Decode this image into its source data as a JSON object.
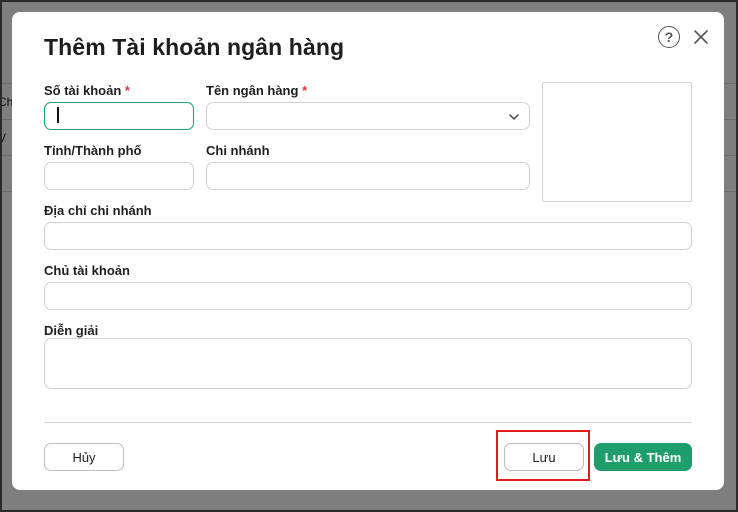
{
  "backdrop": {
    "rows": [
      "Ch",
      "V"
    ]
  },
  "modal": {
    "title": "Thêm Tài khoản ngân hàng",
    "help_glyph": "?",
    "fields": {
      "account_number": {
        "label": "Số tài khoản",
        "required_mark": "*",
        "value": ""
      },
      "bank_name": {
        "label": "Tên ngân hàng",
        "required_mark": "*",
        "value": ""
      },
      "province": {
        "label": "Tỉnh/Thành phố",
        "value": ""
      },
      "branch": {
        "label": "Chi nhánh",
        "value": ""
      },
      "branch_address": {
        "label": "Địa chỉ chi nhánh",
        "value": ""
      },
      "account_holder": {
        "label": "Chủ tài khoản",
        "value": ""
      },
      "description": {
        "label": "Diễn giải",
        "value": ""
      }
    },
    "buttons": {
      "cancel": "Hủy",
      "save": "Lưu",
      "save_add": "Lưu & Thêm"
    }
  },
  "colors": {
    "accent": "#1e9e6a",
    "required": "#e53935",
    "highlight": "#e01c1c"
  }
}
